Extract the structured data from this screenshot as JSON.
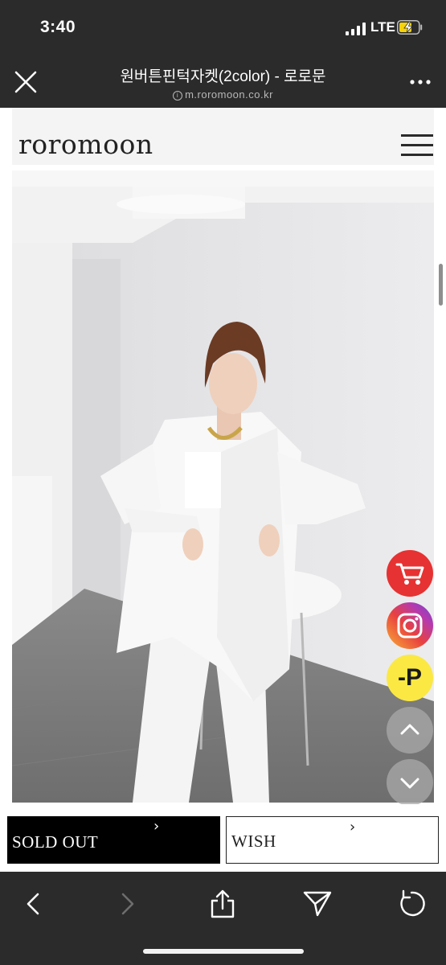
{
  "status_bar": {
    "time": "3:40",
    "network": "LTE",
    "signal_icon": "signal-bars-icon",
    "battery_icon": "battery-charging-icon"
  },
  "browser_nav": {
    "title": "원버튼핀턱자켓(2color) - 로로문",
    "url": "m.roromoon.co.kr",
    "close_icon": "close-icon",
    "more_icon": "more-icon"
  },
  "site": {
    "logo": "roromoon",
    "menu_icon": "hamburger-menu-icon"
  },
  "floating_buttons": [
    {
      "name": "cart",
      "icon": "cart-icon",
      "color": "#e63232"
    },
    {
      "name": "instagram",
      "icon": "instagram-icon"
    },
    {
      "name": "point",
      "icon": "point-icon",
      "label": "-P",
      "color": "#fbe843"
    },
    {
      "name": "scroll-up",
      "icon": "chevron-up-icon"
    },
    {
      "name": "scroll-down",
      "icon": "chevron-down-icon"
    }
  ],
  "actions": {
    "sold_out_label": "SOLD OUT",
    "wish_label": "WISH",
    "chevron": "›"
  },
  "toolbar": {
    "icons": [
      "back-icon",
      "forward-icon",
      "share-icon",
      "send-icon",
      "reload-icon"
    ]
  }
}
